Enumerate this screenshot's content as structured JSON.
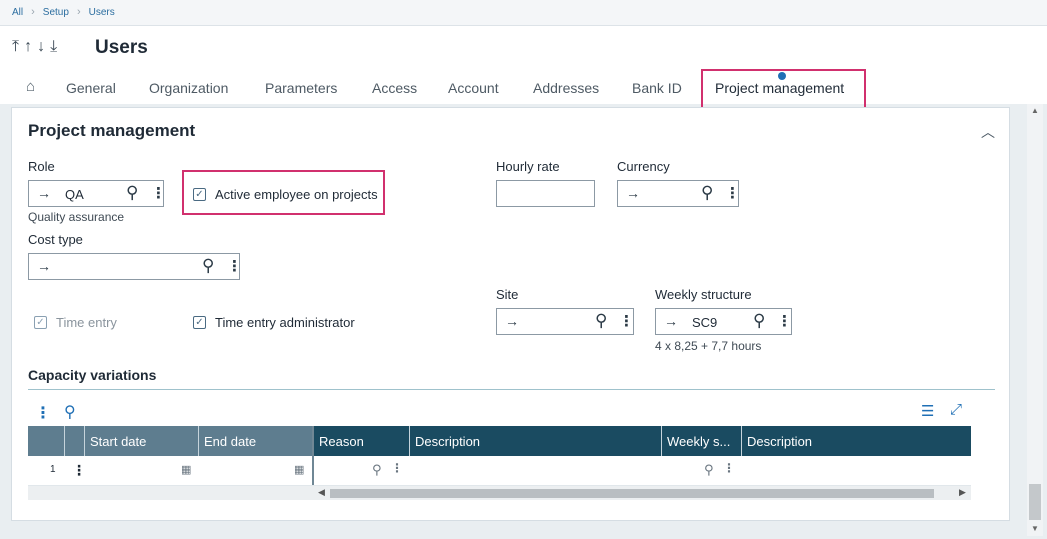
{
  "breadcrumb": [
    "All",
    "Setup",
    "Users"
  ],
  "header": {
    "title": "Users"
  },
  "tabs": [
    {
      "label": "General"
    },
    {
      "label": "Organization"
    },
    {
      "label": "Parameters"
    },
    {
      "label": "Access"
    },
    {
      "label": "Account"
    },
    {
      "label": "Addresses"
    },
    {
      "label": "Bank ID"
    },
    {
      "label": "Project management",
      "active": true
    }
  ],
  "section": {
    "title": "Project management",
    "role": {
      "label": "Role",
      "value": "QA",
      "description": "Quality assurance"
    },
    "active_employee": {
      "label": "Active employee on projects",
      "checked": true
    },
    "hourly_rate": {
      "label": "Hourly rate",
      "value": ""
    },
    "currency": {
      "label": "Currency",
      "value": ""
    },
    "cost_type": {
      "label": "Cost type",
      "value": ""
    },
    "time_entry": {
      "label": "Time entry",
      "checked": true,
      "disabled": true
    },
    "time_entry_admin": {
      "label": "Time entry administrator",
      "checked": true
    },
    "site": {
      "label": "Site",
      "value": ""
    },
    "weekly_structure": {
      "label": "Weekly structure",
      "value": "SC9",
      "description": "4 x 8,25 + 7,7 hours"
    }
  },
  "capacity": {
    "title": "Capacity variations",
    "columns": [
      "Start date",
      "End date",
      "Reason",
      "Description",
      "Weekly s...",
      "Description"
    ],
    "rows": [
      {
        "num": "1",
        "start": "",
        "end": "",
        "reason": "",
        "description": "",
        "weekly": "",
        "description2": ""
      }
    ]
  },
  "colors": {
    "accent": "#1f6fb5",
    "highlight": "#d1306e",
    "grid_header": "#1a4b61"
  }
}
